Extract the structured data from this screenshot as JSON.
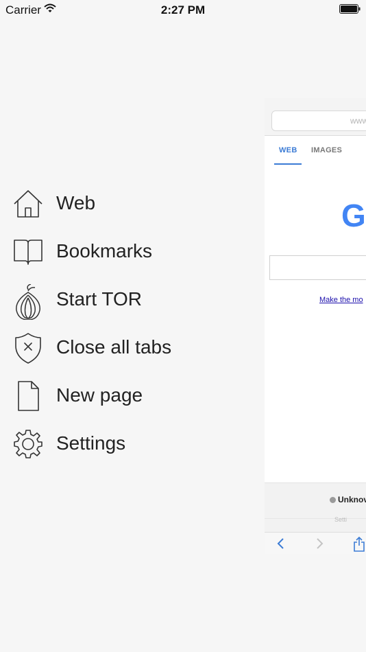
{
  "status_bar": {
    "carrier": "Carrier",
    "time": "2:27 PM"
  },
  "menu": {
    "items": [
      {
        "label": "Web",
        "icon": "home-icon"
      },
      {
        "label": "Bookmarks",
        "icon": "book-icon"
      },
      {
        "label": "Start TOR",
        "icon": "onion-icon"
      },
      {
        "label": "Close all tabs",
        "icon": "shield-x-icon"
      },
      {
        "label": "New page",
        "icon": "document-icon"
      },
      {
        "label": "Settings",
        "icon": "gear-icon"
      }
    ]
  },
  "preview": {
    "url_text": "www",
    "tabs": [
      "WEB",
      "IMAGES"
    ],
    "logo_letter": "G",
    "link_text": "Make the mo",
    "footer_status": "Unknov",
    "footer_faint": "Setti"
  },
  "colors": {
    "accent": "#3b7bd5",
    "google_blue": "#4285f4",
    "link": "#1a0dab",
    "background": "#f6f6f6"
  }
}
